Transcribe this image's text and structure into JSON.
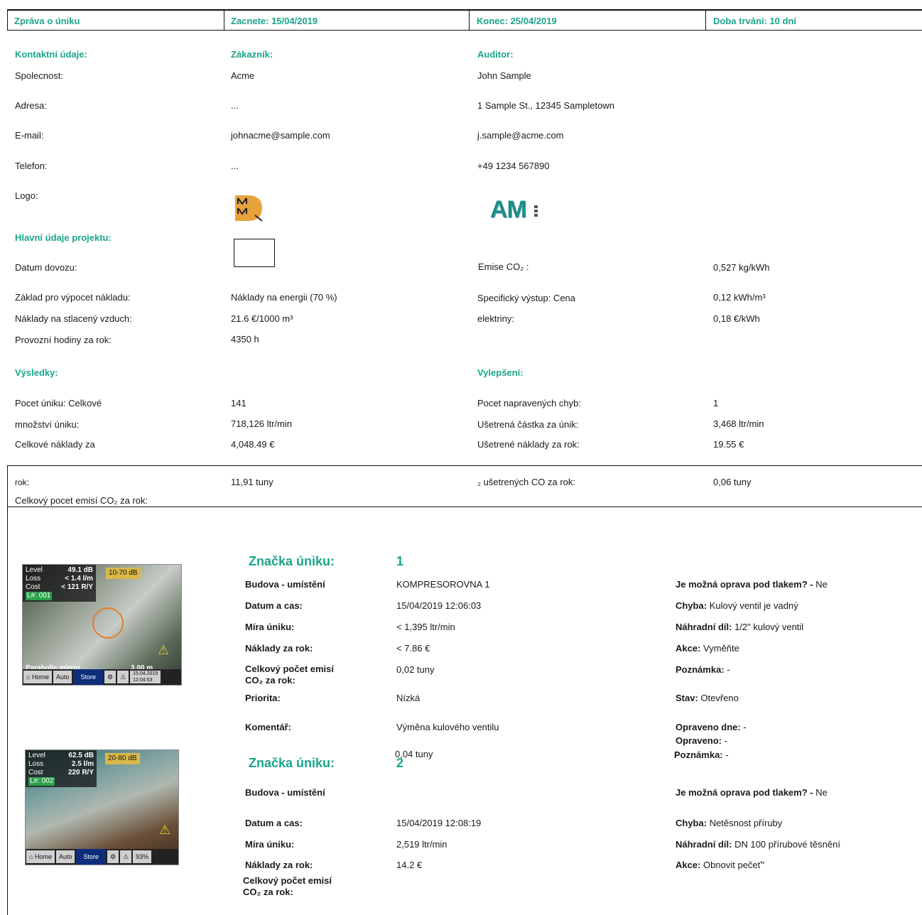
{
  "header": {
    "title": "Zpráva o úniku",
    "start": "Zacnete: 15/04/2019",
    "end": "Konec: 25/04/2019",
    "duration": "Doba trvání: 10 dní"
  },
  "contacts": {
    "heading": "Kontaktní údaje:",
    "customer_heading": "Zákazník:",
    "auditor_heading": "Auditor:",
    "rows": [
      {
        "label": "Spolecnost:",
        "customer": "Acme",
        "auditor": "John Sample"
      },
      {
        "label": "Adresa:",
        "customer": "...",
        "auditor": "1 Sample St., 12345 Sampletown"
      },
      {
        "label": "E-mail:",
        "customer": "johnacme@sample.com",
        "auditor": "j.sample@acme.com"
      },
      {
        "label": "Telefon:",
        "customer": "...",
        "auditor": "+49 1234 567890"
      },
      {
        "label": "Logo:"
      }
    ],
    "auditor_logo_text": "AM"
  },
  "project": {
    "heading": "Hlavní údaje projektu:",
    "import_date_label": "Datum dovozu:",
    "co2_label": "Emise CO₂ :",
    "co2_value": "0,527 kg/kWh",
    "cost_basis_label": "Základ pro výpocet nákladu:",
    "cost_basis_value": "Náklady na energii (70 %)",
    "specific_label": "Specifický výstup: Cena",
    "specific_value": "0,12 kWh/m³",
    "air_cost_label": "Náklady na stlacený vzduch:",
    "air_cost_value": "21.6 €/1000 m³",
    "electricity_label": "elektriny:",
    "electricity_value": "0,18 €/kWh",
    "hours_label": "Provozní hodiny za rok:",
    "hours_value": "4350 h"
  },
  "results": {
    "heading": "Výsledky:",
    "count_label": "Pocet úniku: Celkové",
    "count_value": "141",
    "amount_label": "množství úniku:",
    "amount_value": "718,126 ltr/min",
    "cost_label": "Celkové náklady za",
    "cost_value": "4,048.49 €",
    "rok_label": "rok:",
    "emission_value": "11,91 tuny",
    "emission_label": "Celkový pocet emisí CO₂ za rok:"
  },
  "improvements": {
    "heading": "Vylepšení:",
    "fixed_label": "Pocet napravených chyb:",
    "fixed_value": "1",
    "saved_amount_label": "Ušetrená částka za únik:",
    "saved_amount_value": "3,468 ltr/min",
    "saved_cost_label": "Ušetrené náklady za rok:",
    "saved_cost_value": "19.55 €",
    "co2_saved_label": "₂ ušetrených CO za rok:",
    "co2_saved_value": "0,06 tuny"
  },
  "leak1": {
    "tag_label": "Značka úniku:",
    "tag_value": "1",
    "building_label": "Budova - umístění",
    "building_value": "KOMPRESOROVNA 1",
    "datetime_label": "Datum a cas:",
    "datetime_value": "15/04/2019 12:06:03",
    "rate_label": "Míra úniku:",
    "rate_value": "< 1,395 ltr/min",
    "cost_label": "Náklady za rok:",
    "cost_value": "< 7.86 €",
    "emission_label_1": "Celkový počet emisí",
    "emission_label_2": "CO₂ za rok:",
    "emission_value": "0,02 tuny",
    "priority_label": "Priorita:",
    "priority_value": "Nízká",
    "comment_label": "Komentář:",
    "comment_value": "Výměna kulového ventilu",
    "repair_label": "Je možná oprava pod tlakem? -",
    "repair_value": "Ne",
    "fault_label": "Chyba:",
    "fault_value": "Kulový ventil je vadný",
    "part_label": "Náhradní díl:",
    "part_value": "1/2\" kulový ventil",
    "action_label": "Akce:",
    "action_value": "Vyměňte",
    "note_label": "Poznámka:",
    "note_value": "-",
    "state_label": "Stav:",
    "state_value": "Otevřeno",
    "fixed_date_label": "Opraveno dne:",
    "fixed_date_value": "-",
    "fixed_by_label": "Opraveno:",
    "fixed_by_value": "-",
    "note2_label": "Poznámka:",
    "note2_value": "-",
    "thumb": {
      "level": "Level",
      "level_v": "49.1 dB",
      "range": "10-70 dB",
      "loss": "Loss",
      "loss_v": "< 1.4 l/m",
      "cost": "Cost",
      "cost_v": "< 121 R/Y",
      "id": "L#: 001",
      "mirror": "Parabolic mirror",
      "dist": "3.00 m",
      "btn_home": "Home",
      "btn_auto": "Auto",
      "btn_store": "Store",
      "date": "15.04.2019",
      "time": "12:04:53"
    }
  },
  "leak2": {
    "tonnes_value": "0,04 tuny",
    "tag_label": "Značka úniku:",
    "tag_value": "2",
    "building_label": "Budova - umístění",
    "datetime_label": "Datum a cas:",
    "datetime_value": "15/04/2019 12:08:19",
    "rate_label": "Míra úniku:",
    "rate_value": "2,519 ltr/min",
    "cost_label": "Náklady za rok:",
    "cost_value": "14.2 €",
    "emission_label_1": "Celkový počet emisí",
    "emission_label_2": "CO₂ za rok:",
    "repair_label": "Je možná oprava pod tlakem? -",
    "repair_value": "Ne",
    "fault_label": "Chyba:",
    "fault_value": "Netěsnost příruby",
    "part_label": "Náhradní díl:",
    "part_value": "DN 100 přírubové těsnění",
    "action_label": "Akce:",
    "action_value": "Obnovit pečeť\"",
    "thumb": {
      "level": "Level",
      "level_v": "62.5 dB",
      "range": "20-80 dB",
      "loss": "Loss",
      "loss_v": "2.5 l/m",
      "cost": "Cost",
      "cost_v": "220 R/Y",
      "id": "L#: 002",
      "btn_home": "Home",
      "btn_auto": "Auto",
      "btn_store": "Store",
      "battery": "93%"
    }
  }
}
